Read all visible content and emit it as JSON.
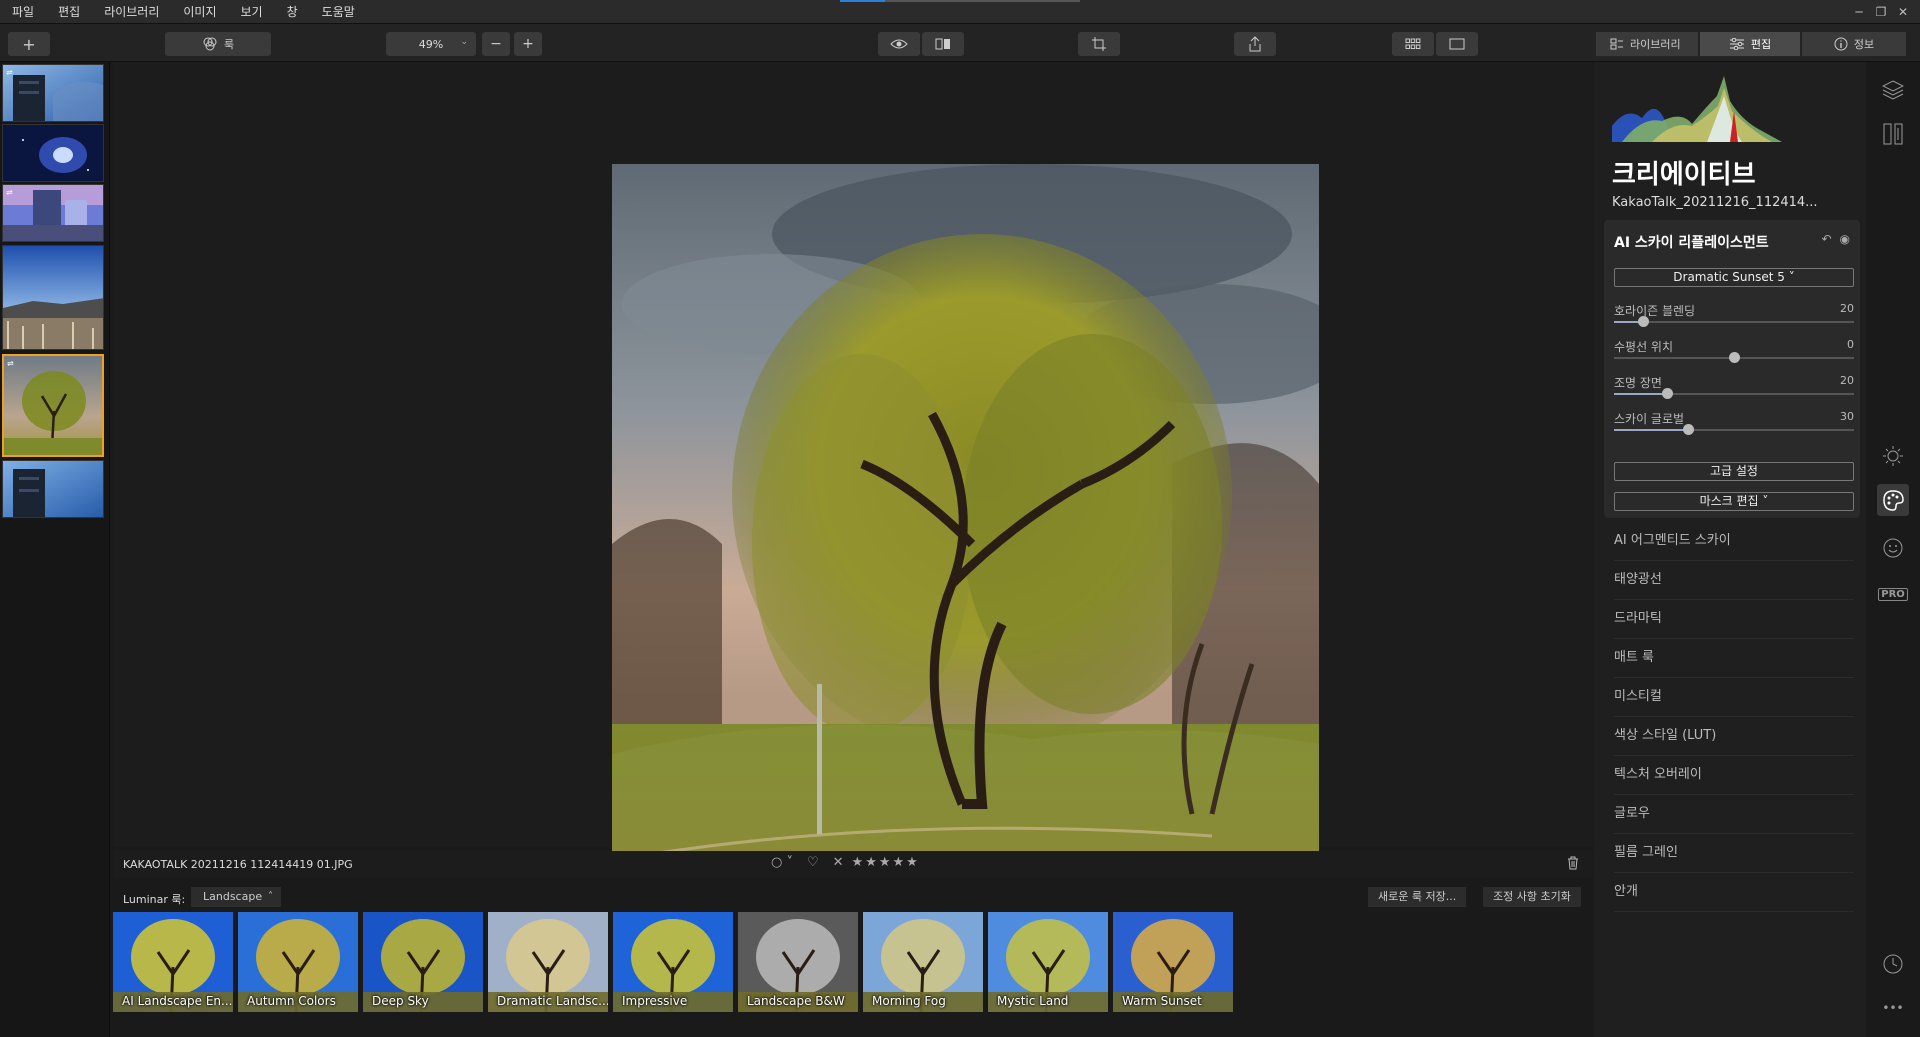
{
  "menu": [
    "파일",
    "편집",
    "라이브러리",
    "이미지",
    "보기",
    "창",
    "도움말"
  ],
  "window_controls": {
    "minimize": "─",
    "maximize": "❐",
    "close": "✕"
  },
  "toolbar": {
    "add_label": "+",
    "looks_label": "룩",
    "zoom_value": "49%",
    "zoom_caret": "⌄",
    "zoom_out": "−",
    "zoom_in": "+",
    "tabs": [
      {
        "label": "라이브러리",
        "icon": "library-icon"
      },
      {
        "label": "편집",
        "icon": "sliders-icon"
      },
      {
        "label": "정보",
        "icon": "info-icon"
      }
    ]
  },
  "info": {
    "filename": "KAKAOTALK 20211216 112414419 01.JPG",
    "flag_label": "○ ˅",
    "heart": "♡",
    "reject": "✕",
    "stars": "★★★★★",
    "trash": "🗑"
  },
  "looks": {
    "label": "Luminar 룩:",
    "category": "Landscape",
    "category_caret": "˄",
    "save_label": "새로운 룩 저장...",
    "reset_label": "조정 사항 초기화",
    "presets": [
      "AI Landscape En...",
      "Autumn Colors",
      "Deep Sky",
      "Dramatic Landsc...",
      "Impressive",
      "Landscape B&W",
      "Morning Fog",
      "Mystic Land",
      "Warm Sunset"
    ]
  },
  "panel": {
    "title": "크리에이티브",
    "file": "KakaoTalk_20211216_112414...",
    "tool": {
      "title": "AI 스카이 리플레이스먼트",
      "undo_icon": "↶",
      "visibility_icon": "◉",
      "sky_select": "Dramatic Sunset 5 ˅",
      "sliders": [
        {
          "label": "호라이즌 블렌딩",
          "value": "20",
          "level": 0.12
        },
        {
          "label": "수평선 위치",
          "value": "0",
          "level": 0.5
        },
        {
          "label": "조명 장면",
          "value": "20",
          "level": 0.22
        },
        {
          "label": "스카이 글로벌",
          "value": "30",
          "level": 0.31
        }
      ],
      "advanced_label": "고급 설정",
      "mask_label": "마스크 편집 ˅"
    },
    "tools": [
      "AI 어그멘티드 스카이",
      "태양광선",
      "드라마틱",
      "매트 룩",
      "미스티컬",
      "색상 스타일 (LUT)",
      "텍스처 오버레이",
      "글로우",
      "필름 그레인",
      "안개"
    ]
  },
  "side_icons": {
    "pro": "PRO",
    "more": "•••"
  }
}
